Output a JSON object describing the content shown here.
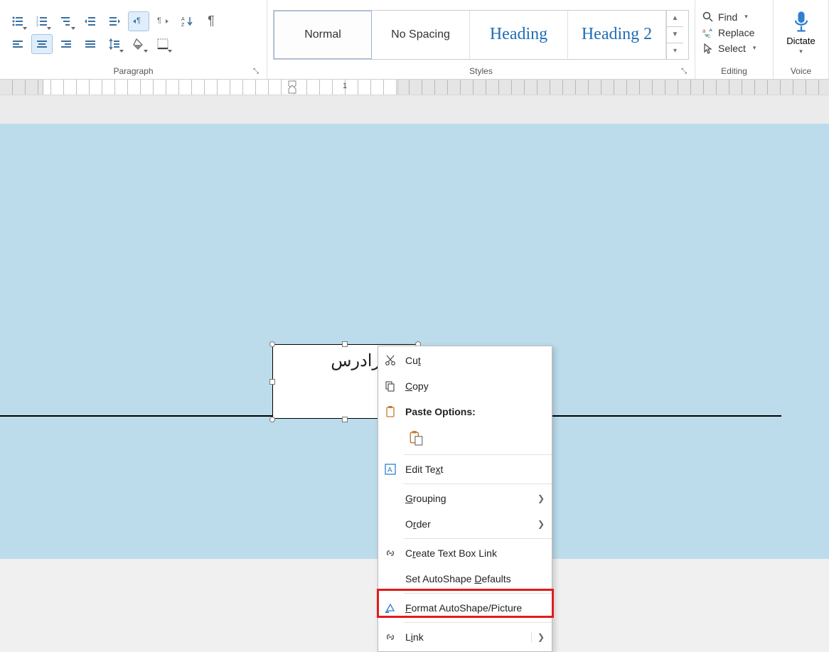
{
  "ribbon": {
    "paragraph": {
      "label": "Paragraph",
      "row1": [
        "bullets",
        "numbering",
        "multilevel",
        "decrease-indent",
        "increase-indent",
        "ltr-para",
        "rtl-para",
        "sort",
        "pilcrow"
      ],
      "row2": [
        "align-left",
        "align-center",
        "align-right",
        "justify",
        "line-spacing",
        "shading",
        "borders"
      ]
    },
    "styles": {
      "label": "Styles",
      "items": [
        {
          "name": "Normal",
          "selected": true,
          "heading": false
        },
        {
          "name": "No Spacing",
          "selected": false,
          "heading": false
        },
        {
          "name": "Heading",
          "selected": false,
          "heading": true
        },
        {
          "name": "Heading 2",
          "selected": false,
          "heading": true
        }
      ]
    },
    "editing": {
      "label": "Editing",
      "find": "Find",
      "replace": "Replace",
      "select": "Select"
    },
    "voice": {
      "label": "Voice",
      "dictate": "Dictate"
    }
  },
  "ruler": {
    "num": "1"
  },
  "textbox": {
    "text": "له فرادرس"
  },
  "context_menu": {
    "cut": "Cut",
    "copy": "Copy",
    "paste_options": "Paste Options:",
    "edit_text": "Edit Text",
    "grouping": "Grouping",
    "order": "Order",
    "create_link": "Create Text Box Link",
    "set_defaults": "Set AutoShape Defaults",
    "format_autoshape": "Format AutoShape/Picture",
    "link": "Link",
    "cut_key": "t",
    "copy_key": "C",
    "edit_key": "x",
    "grouping_key": "G",
    "order_key": "r",
    "create_key": "r",
    "defaults_key": "D",
    "format_key": "F",
    "link_key": "i"
  }
}
